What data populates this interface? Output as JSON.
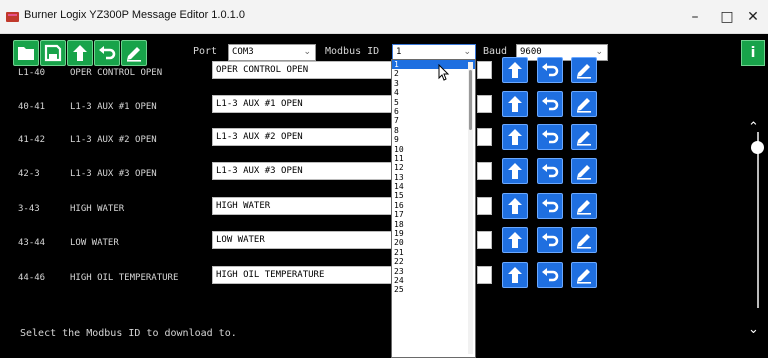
{
  "window": {
    "title": "Burner Logix YZ300P Message Editor 1.0.1.0"
  },
  "toolbar": {
    "port_label": "Port",
    "port_value": "COM3",
    "modbus_label": "Modbus ID",
    "modbus_value": "1",
    "baud_label": "Baud",
    "baud_value": "9600",
    "info_label": "i"
  },
  "rows": [
    {
      "code": "L1-40",
      "desc": "OPER CONTROL OPEN",
      "value": "OPER CONTROL OPEN"
    },
    {
      "code": "40-41",
      "desc": "L1-3 AUX #1 OPEN",
      "value": "L1-3 AUX #1 OPEN"
    },
    {
      "code": "41-42",
      "desc": "L1-3 AUX #2 OPEN",
      "value": "L1-3 AUX #2 OPEN"
    },
    {
      "code": "42-3",
      "desc": "L1-3 AUX #3 OPEN",
      "value": "L1-3 AUX #3 OPEN"
    },
    {
      "code": "3-43",
      "desc": "HIGH WATER",
      "value": "HIGH WATER"
    },
    {
      "code": "43-44",
      "desc": "LOW WATER",
      "value": "LOW WATER"
    },
    {
      "code": "44-46",
      "desc": "HIGH OIL TEMPERATURE",
      "value": "HIGH OIL TEMPERATURE"
    }
  ],
  "modbus_options": [
    "1",
    "2",
    "3",
    "4",
    "5",
    "6",
    "7",
    "8",
    "9",
    "10",
    "11",
    "12",
    "13",
    "14",
    "15",
    "16",
    "17",
    "18",
    "19",
    "20",
    "21",
    "22",
    "23",
    "24",
    "25"
  ],
  "status": "Select the Modbus ID to download to.",
  "colors": {
    "toolbar_button": "#18a34a",
    "row_button": "#1f6fe0",
    "selection": "#1e6fe0",
    "background": "#000000"
  }
}
